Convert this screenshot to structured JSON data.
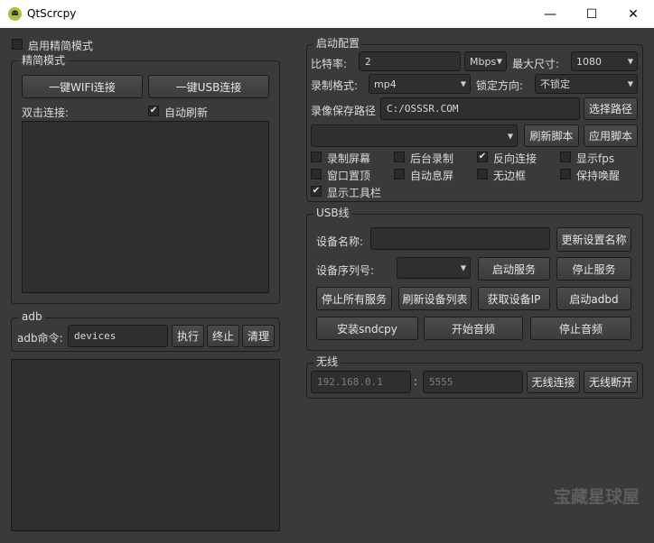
{
  "window": {
    "title": "QtScrcpy",
    "minimize_icon": "minimize-icon",
    "maximize_icon": "maximize-icon",
    "close_icon": "close-icon",
    "minimize_glyph": "—",
    "maximize_glyph": "☐",
    "close_glyph": "✕"
  },
  "left": {
    "simple_mode_checkbox": {
      "label": "启用精简模式",
      "checked": false
    },
    "simple_group": {
      "title": "精简模式",
      "wifi_button": "一键WIFI连接",
      "usb_button": "一键USB连接",
      "double_click_label": "双击连接:",
      "auto_refresh": {
        "label": "自动刷新",
        "checked": true
      }
    },
    "adb_group": {
      "title": "adb",
      "command_label": "adb命令:",
      "command_value": "devices",
      "execute_button": "执行",
      "terminate_button": "终止",
      "clear_button": "清理"
    }
  },
  "config": {
    "title": "启动配置",
    "bitrate_label": "比特率:",
    "bitrate_value": "2",
    "bitrate_unit": "Mbps",
    "max_size_label": "最大尺寸:",
    "max_size_value": "1080",
    "record_format_label": "录制格式:",
    "record_format_value": "mp4",
    "lock_orientation_label": "锁定方向:",
    "lock_orientation_value": "不锁定",
    "save_path_label": "录像保存路径",
    "save_path_value": "C:/OSSSR.COM",
    "select_path_button": "选择路径",
    "refresh_script_button": "刷新脚本",
    "apply_script_button": "应用脚本",
    "options": [
      {
        "label": "录制屏幕",
        "checked": false
      },
      {
        "label": "后台录制",
        "checked": false
      },
      {
        "label": "反向连接",
        "checked": true
      },
      {
        "label": "显示fps",
        "checked": false
      },
      {
        "label": "窗口置顶",
        "checked": false
      },
      {
        "label": "自动息屏",
        "checked": false
      },
      {
        "label": "无边框",
        "checked": false
      },
      {
        "label": "保持唤醒",
        "checked": false
      },
      {
        "label": "显示工具栏",
        "checked": true
      }
    ]
  },
  "usb": {
    "title": "USB线",
    "device_name_label": "设备名称:",
    "device_name_value": "",
    "update_name_button": "更新设置名称",
    "serial_label": "设备序列号:",
    "start_service_button": "启动服务",
    "stop_service_button": "停止服务",
    "stop_all_button": "停止所有服务",
    "refresh_devices_button": "刷新设备列表",
    "get_ip_button": "获取设备IP",
    "start_adbd_button": "启动adbd",
    "install_sndcpy_button": "安装sndcpy",
    "start_audio_button": "开始音频",
    "stop_audio_button": "停止音频"
  },
  "wireless": {
    "title": "无线",
    "ip_placeholder": "192.168.0.1",
    "separator": ":",
    "port_placeholder": "5555",
    "connect_button": "无线连接",
    "disconnect_button": "无线断开"
  },
  "watermark": "宝藏星球屋",
  "colors": {
    "window_bg": "#3a3a3a",
    "titlebar_bg": "#ffffff",
    "field_bg": "#2f2f2f",
    "border": "#1a1a1a",
    "text": "#dcdcdc"
  }
}
